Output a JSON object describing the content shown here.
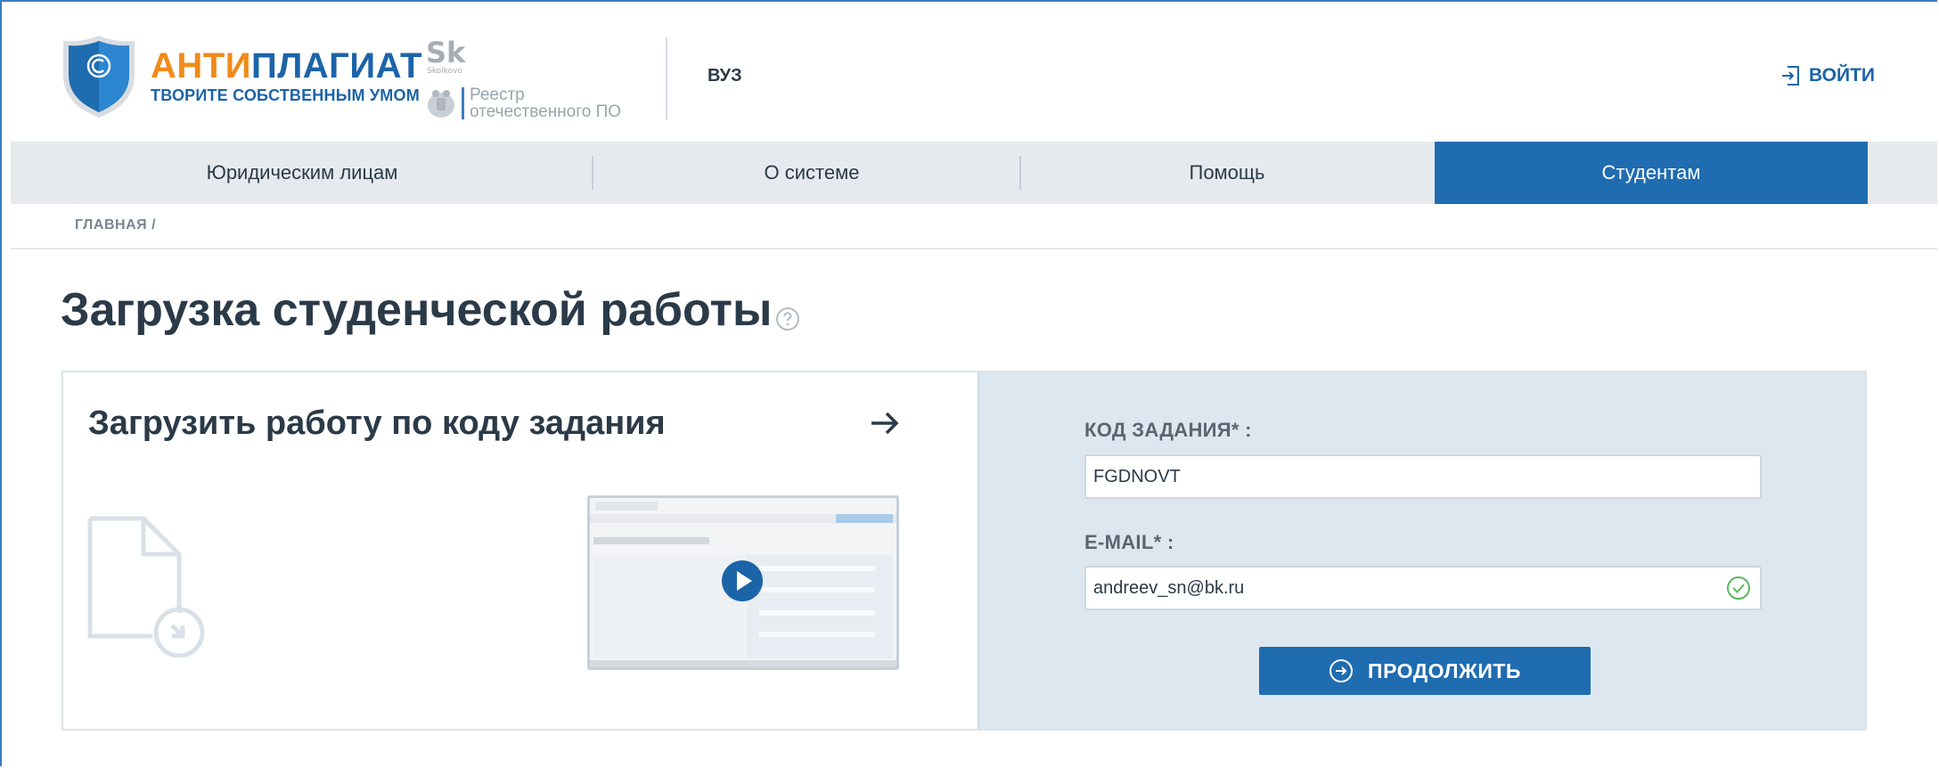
{
  "header": {
    "brand_anti": "АНТИ",
    "brand_plagiat": "ПЛАГИАТ",
    "slogan": "ТВОРИТЕ СОБСТВЕННЫМ УМОМ",
    "sk_text": "Sk",
    "sk_sub": "Skolkovo",
    "reestr_line1": "Реестр",
    "reestr_line2": "отечественного ПО",
    "section": "ВУЗ",
    "login_label": "ВОЙТИ"
  },
  "nav": {
    "items": [
      {
        "label": "Юридическим лицам"
      },
      {
        "label": "О системе"
      },
      {
        "label": "Помощь"
      },
      {
        "label": "Студентам"
      }
    ]
  },
  "breadcrumb": "ГЛАВНАЯ /",
  "page": {
    "title": "Загрузка студенческой работы"
  },
  "card": {
    "title": "Загрузить работу по коду задания",
    "form": {
      "code_label": "КОД ЗАДАНИЯ* :",
      "code_value": "FGDNOVT",
      "email_label": "E-MAIL* :",
      "email_value": "andreev_sn@bk.ru",
      "submit_label": "ПРОДОЛЖИТЬ"
    }
  },
  "colors": {
    "accent": "#1f6cb0",
    "brand_orange": "#f08a1c",
    "panel_bg": "#dde7f0",
    "nav_bg": "#e6eaef",
    "valid_green": "#5cb85c"
  },
  "icons": {
    "logo": "shield-copyright-icon",
    "login": "login-icon",
    "help": "question-circle-icon",
    "arrow": "arrow-right-icon",
    "document": "document-upload-icon",
    "play": "play-icon",
    "valid": "check-circle-icon",
    "continue": "arrow-circle-right-icon"
  }
}
